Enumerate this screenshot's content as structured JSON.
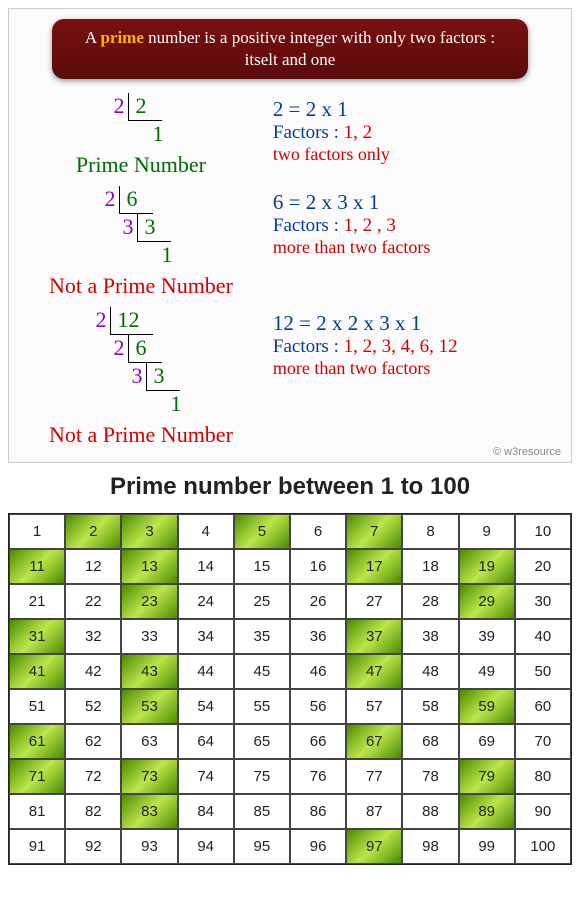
{
  "header": {
    "prefix": "A ",
    "prime_word": "prime",
    "suffix": " number is a positive integer with only two factors : itselt and one"
  },
  "examples": [
    {
      "steps": [
        {
          "divisor": "2",
          "dividend": "2"
        }
      ],
      "final": "1",
      "verdict": "Prime Number",
      "is_prime": true,
      "eq": "2 = 2 x 1",
      "factors_label": "Factors : ",
      "factors_list": "1, 2",
      "desc": "two factors only"
    },
    {
      "steps": [
        {
          "divisor": "2",
          "dividend": "6"
        },
        {
          "divisor": "3",
          "dividend": "3"
        }
      ],
      "final": "1",
      "verdict": "Not a Prime Number",
      "is_prime": false,
      "eq": "6 = 2 x 3 x 1",
      "factors_label": "Factors :  ",
      "factors_list": "1, 2 , 3",
      "desc": "more than two factors"
    },
    {
      "steps": [
        {
          "divisor": "2",
          "dividend": "12"
        },
        {
          "divisor": "2",
          "dividend": "6"
        },
        {
          "divisor": "3",
          "dividend": "3"
        }
      ],
      "final": "1",
      "verdict": "Not a Prime Number",
      "is_prime": false,
      "eq": "12 = 2 x 2 x 3 x 1",
      "factors_label": "Factors : ",
      "factors_list": "1, 2, 3, 4, 6, 12",
      "desc": "more than two factors"
    }
  ],
  "credit": "© w3resource",
  "grid_title": "Prime number between 1 to 100",
  "chart_data": {
    "type": "table",
    "title": "Prime number between 1 to 100",
    "range": [
      1,
      100
    ],
    "primes": [
      2,
      3,
      5,
      7,
      11,
      13,
      17,
      19,
      23,
      29,
      31,
      37,
      41,
      43,
      47,
      53,
      59,
      61,
      67,
      71,
      73,
      79,
      83,
      89,
      97
    ]
  }
}
